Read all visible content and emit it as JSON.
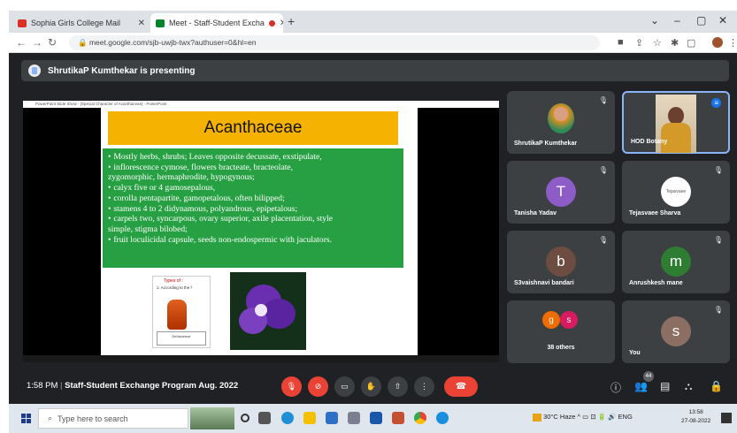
{
  "browser": {
    "tabs": [
      {
        "label": "Sophia Girls College Mail",
        "color": "#d93025"
      },
      {
        "label": "Meet - Staff-Student Excha",
        "color": "#00832d"
      }
    ],
    "url": "meet.google.com/sjb-uwjb-twx?authuser=0&hl=en"
  },
  "meet": {
    "presenting_banner": "ShrutikaP Kumthekar is presenting",
    "slide": {
      "app_bar": "PowerPoint Slide Show - [Special Character of Acanthaceae] - PowerPoint",
      "title": "Acanthaceae",
      "bullets": [
        "Mostly herbs, shrubs; Leaves opposite decussate, exstipulate,",
        "inflorescence cymose, flowers bracteate, bracteolate,",
        "zygomorphic, hermaphrodite, hypogynous;",
        "calyx five or 4 gamosepalous,",
        "corolla pentapartite, gamopetalous, often bilipped;",
        "stamens 4 to 2 didynamous, polyandrous, epipetalous;",
        "carpels two, syncarpous, ovary superior, axile placentation, style",
        "simple, stigma bilobed;",
        "fruit loculicidal capsule, seeds non-endospermic with jaculators."
      ],
      "bullet_flags": [
        true,
        true,
        false,
        true,
        true,
        true,
        true,
        false,
        true
      ],
      "image_card": {
        "title": "Types of :",
        "subtitle": "1. According to the f",
        "caption": "Dehiscence"
      }
    },
    "participants": [
      {
        "name": "ShrutikaP Kumthekar",
        "kind": "photo"
      },
      {
        "name": "HOD Botany",
        "kind": "video"
      },
      {
        "name": "Tanisha Yadav",
        "initial": "T",
        "color": "#8e5cc7"
      },
      {
        "name": "Tejasvaee Sharva",
        "kind": "logo",
        "logo_text": "Tejasvaee"
      },
      {
        "name": "S3vaishnavi bandari",
        "initial": "b",
        "color": "#6d4c41"
      },
      {
        "name": "Anrushkesh mane",
        "initial": "m",
        "color": "#2e7d32"
      },
      {
        "name": "38 others",
        "kind": "group",
        "initials": [
          "g",
          "s"
        ],
        "colors": [
          "#ef6c00",
          "#d81b60"
        ]
      },
      {
        "name": "You",
        "initial": "s",
        "color": "#8d6e63"
      }
    ],
    "time": "1:58 PM",
    "meeting_title": "Staff-Student Exchange Program Aug. 2022",
    "people_count": "44"
  },
  "taskbar": {
    "search_placeholder": "Type here to search",
    "weather": "30°C Haze",
    "lang": "ENG",
    "clock_time": "13:58",
    "clock_date": "27-08-2022"
  }
}
